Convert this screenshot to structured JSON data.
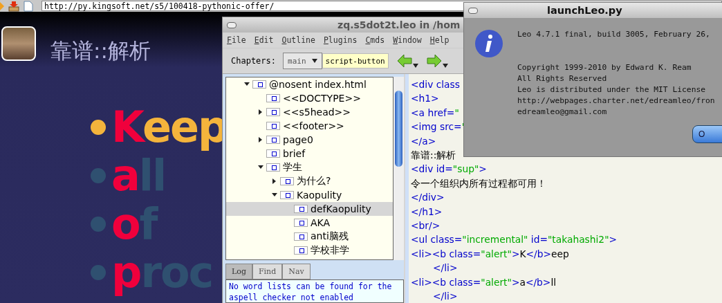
{
  "browser": {
    "url": "http://py.kingsoft.net/s5/100418-pythonic-offer/"
  },
  "slide": {
    "title": "靠谱::解析",
    "bullets": [
      {
        "alert": "K",
        "rest": "eep",
        "selected": true
      },
      {
        "alert": "a",
        "rest": "ll",
        "selected": false
      },
      {
        "alert": "o",
        "rest": "f",
        "selected": false
      },
      {
        "alert": "p",
        "rest": "roc",
        "selected": false
      }
    ]
  },
  "leo_window": {
    "title": "zq.s5dot2t.leo in /hom",
    "menu": [
      "File",
      "Edit",
      "Outline",
      "Plugins",
      "Cmds",
      "Window",
      "Help"
    ],
    "toolbar": {
      "chapters_label": "Chapters:",
      "chapter": "main",
      "script_button": "script-button"
    },
    "outline": [
      {
        "label": "@nosent index.html",
        "expanded": true,
        "selected": false,
        "children": [
          {
            "label": "<<DOCTYPE>>",
            "selected": false
          },
          {
            "label": "<<s5head>>",
            "expanded": false,
            "selected": false
          },
          {
            "label": "<<footer>>",
            "selected": false
          },
          {
            "label": "page0",
            "expanded": false,
            "selected": false
          },
          {
            "label": "brief",
            "selected": false
          },
          {
            "label": "学生",
            "expanded": true,
            "selected": false,
            "children": [
              {
                "label": "为什么?",
                "expanded": false,
                "selected": false
              },
              {
                "label": "Kaopulity",
                "expanded": true,
                "selected": false,
                "children": [
                  {
                    "label": "defKaopulity",
                    "selected": true
                  },
                  {
                    "label": "AKA",
                    "selected": false
                  },
                  {
                    "label": "anti脑残",
                    "selected": false
                  },
                  {
                    "label": "学校非学",
                    "selected": false
                  }
                ]
              }
            ]
          }
        ]
      }
    ],
    "log_tabs": [
      {
        "label": "Log",
        "selected": true
      },
      {
        "label": "Find",
        "selected": false
      },
      {
        "label": "Nav",
        "selected": false
      }
    ],
    "log_lines": [
      "No word lists can be found for the",
      "aspell checker not enabled"
    ],
    "body_lines": [
      {
        "indented": false,
        "segments": [
          {
            "kind": "tag",
            "text": "<div class"
          }
        ]
      },
      {
        "indented": false,
        "segments": [
          {
            "kind": "tag",
            "text": "<h1>"
          }
        ]
      },
      {
        "indented": false,
        "segments": [
          {
            "kind": "tag",
            "text": "<a href="
          },
          {
            "kind": "string",
            "text": "\""
          }
        ]
      },
      {
        "indented": false,
        "segments": [
          {
            "kind": "tag",
            "text": "<img src="
          },
          {
            "kind": "string",
            "text": "\""
          }
        ]
      },
      {
        "indented": false,
        "segments": [
          {
            "kind": "tag",
            "text": "</a>"
          }
        ]
      },
      {
        "indented": false,
        "segments": [
          {
            "kind": "text",
            "text": "靠谱::解析"
          }
        ]
      },
      {
        "indented": false,
        "segments": [
          {
            "kind": "tag",
            "text": "<div id="
          },
          {
            "kind": "string",
            "text": "\"sup\""
          },
          {
            "kind": "tag",
            "text": ">"
          }
        ]
      },
      {
        "indented": false,
        "segments": [
          {
            "kind": "text",
            "text": "令一个组织内所有过程都可用！"
          }
        ]
      },
      {
        "indented": false,
        "segments": [
          {
            "kind": "tag",
            "text": "</div>"
          }
        ]
      },
      {
        "indented": false,
        "segments": [
          {
            "kind": "tag",
            "text": "</h1>"
          }
        ]
      },
      {
        "indented": false,
        "segments": [
          {
            "kind": "tag",
            "text": "<br/>"
          }
        ]
      },
      {
        "indented": false,
        "segments": [
          {
            "kind": "tag",
            "text": "<ul class="
          },
          {
            "kind": "string",
            "text": "\"incremental\""
          },
          {
            "kind": "tag",
            "text": " id="
          },
          {
            "kind": "string",
            "text": "\"takahashi2\""
          },
          {
            "kind": "tag",
            "text": ">"
          }
        ]
      },
      {
        "indented": false,
        "segments": [
          {
            "kind": "tag",
            "text": "<li><b class="
          },
          {
            "kind": "string",
            "text": "\"alert\""
          },
          {
            "kind": "tag",
            "text": ">"
          },
          {
            "kind": "text",
            "text": "K"
          },
          {
            "kind": "tag",
            "text": "</b>"
          },
          {
            "kind": "text",
            "text": "eep"
          }
        ]
      },
      {
        "indented": true,
        "segments": [
          {
            "kind": "tag",
            "text": "</li>"
          }
        ]
      },
      {
        "indented": false,
        "segments": [
          {
            "kind": "tag",
            "text": "<li><b class="
          },
          {
            "kind": "string",
            "text": "\"alert\""
          },
          {
            "kind": "tag",
            "text": ">"
          },
          {
            "kind": "text",
            "text": "a"
          },
          {
            "kind": "tag",
            "text": "</b>"
          },
          {
            "kind": "text",
            "text": "ll"
          }
        ]
      },
      {
        "indented": true,
        "segments": [
          {
            "kind": "tag",
            "text": "</li>"
          }
        ]
      }
    ]
  },
  "dialog": {
    "title": "launchLeo.py",
    "version": "Leo 4.7.1 final, build 3005, February 26,",
    "lines": [
      "Copyright 1999-2010 by Edward K. Ream",
      "All Rights Reserved",
      "Leo is distributed under the MIT License",
      "http://webpages.charter.net/edreamleo/fron",
      "edreamleo@gmail.com"
    ],
    "button": "O"
  }
}
